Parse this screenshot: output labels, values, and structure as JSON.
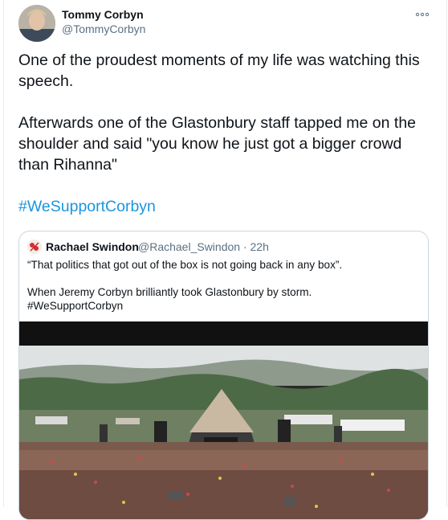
{
  "tweet": {
    "author_name": "Tommy Corbyn",
    "author_handle": "@TommyCorbyn",
    "more_icon": "more-horizontal-icon",
    "text_line1": "One of the proudest moments of my life was watching this speech.",
    "text_line2": "Afterwards one of the Glastonbury staff tapped me on the shoulder and said \"you know he just got a bigger crowd than Rihanna\"",
    "hashtag": "#WeSupportCorbyn"
  },
  "quoted_tweet": {
    "author_name": "Rachael Swindon",
    "author_handle": "@Rachael_Swindon",
    "separator": "·",
    "time": "22h",
    "meta": "@Rachael_Swindon · 22h",
    "text_line1": "“That politics that got out of the box  is not going back in any box”.",
    "text_line2": "When Jeremy Corbyn brilliantly took Glastonbury by storm.",
    "hashtag": "#WeSupportCorbyn",
    "media_icon": "video-thumbnail"
  },
  "colors": {
    "text": "#0f1419",
    "secondary": "#5b7083",
    "link": "#1b95e0",
    "border": "#ccd6dd"
  }
}
